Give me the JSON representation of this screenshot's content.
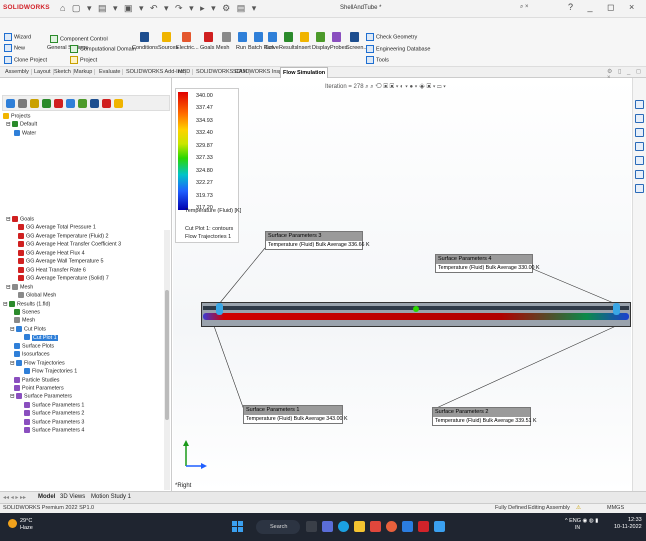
{
  "app": {
    "brand": "SOLIDWORKS",
    "document_title": "ShellAndTube *",
    "search_placeholder": "⌕ ×",
    "window_controls": "? _ ◻ ×"
  },
  "ribbon": {
    "wizard": "Wizard",
    "component_control": "Component Control",
    "new": "New",
    "general_settings": "General Settings",
    "computational_domain": "Computational Domain",
    "clone_project": "Clone Project",
    "project": "Project",
    "conditions": "Conditions",
    "sources": "Sources",
    "electric": "Electric...",
    "goals": "Goals",
    "mesh": "Mesh",
    "run": "Run",
    "batch_run": "Batch Run",
    "solve": "Solve",
    "results": "Results",
    "insert": "Insert",
    "display": "Display",
    "probes": "Probes",
    "screen": "Screen...",
    "check_geometry": "Check Geometry",
    "engineering_database": "Engineering Database",
    "tools": "Tools"
  },
  "tabs": [
    "Assembly",
    "Layout",
    "Sketch",
    "Markup",
    "Evaluate",
    "SOLIDWORKS Add-Ins",
    "MBD",
    "SOLIDWORKS CAM",
    "SOLIDWORKS Inspection",
    "Flow Simulation"
  ],
  "active_tab": "Flow Simulation",
  "tree_top": {
    "projects": "Projects",
    "default": "Default",
    "water": "Water"
  },
  "tree_goals": {
    "goals": "Goals",
    "items": [
      "GG Average Total Pressure 1",
      "GG Average Temperature (Fluid) 2",
      "GG Average Heat Transfer Coefficient 3",
      "GG Average Heat Flux 4",
      "GG Average Wall Temperature 5",
      "GG Heat Transfer Rate 6",
      "GG Average Temperature (Solid) 7"
    ],
    "mesh": "Mesh",
    "global_mesh": "Global Mesh",
    "results": "Results (1.fld)",
    "scenes": "Scenes",
    "mesh2": "Mesh",
    "cut_plots": "Cut Plots",
    "cut_plot_1": "Cut Plot 1",
    "surface_plots": "Surface Plots",
    "isosurfaces": "Isosurfaces",
    "flow_trajectories": "Flow Trajectories",
    "flow_trajectories_1": "Flow Trajectories 1",
    "particle_studies": "Particle Studies",
    "point_parameters": "Point Parameters",
    "surface_parameters": "Surface Parameters",
    "sp1": "Surface Parameters 1",
    "sp2": "Surface Parameters 2",
    "sp3": "Surface Parameters 3",
    "sp4": "Surface Parameters 4"
  },
  "hud": {
    "iteration": "Iteration = 278"
  },
  "legend": {
    "values": [
      "340.00",
      "337.47",
      "334.93",
      "332.40",
      "329.87",
      "327.33",
      "324.80",
      "322.27",
      "319.73",
      "317.20"
    ],
    "title": "Temperature (Fluid) [K]",
    "cut_plot": "Cut Plot 1: contours",
    "flow": "Flow Trajectories 1"
  },
  "surface_params": [
    {
      "title": "Surface Parameters 3",
      "value": "Temperature (Fluid) Bulk Average 336.66 K"
    },
    {
      "title": "Surface Parameters 4",
      "value": "Temperature (Fluid) Bulk Average 330.00 K"
    },
    {
      "title": "Surface Parameters 1",
      "value": "Temperature (Fluid) Bulk Average 343.00 K"
    },
    {
      "title": "Surface Parameters 2",
      "value": "Temperature (Fluid) Bulk Average 339.51 K"
    }
  ],
  "view": {
    "name": "*Right"
  },
  "bottom_tabs": [
    "Model",
    "3D Views",
    "Motion Study 1"
  ],
  "status": {
    "product": "SOLIDWORKS Premium 2022 SP1.0",
    "defined": "Fully Defined",
    "editing": "Editing Assembly",
    "units": "MMGS"
  },
  "taskbar": {
    "temp": "29°C",
    "condition": "Haze",
    "search": "Search",
    "lang": "ENG",
    "region": "IN",
    "time": "12:33",
    "date": "10-11-2022"
  },
  "colors": {
    "accent": "#2f7fd8",
    "brand": "#d2232a",
    "taskbar": "#1f2530"
  }
}
